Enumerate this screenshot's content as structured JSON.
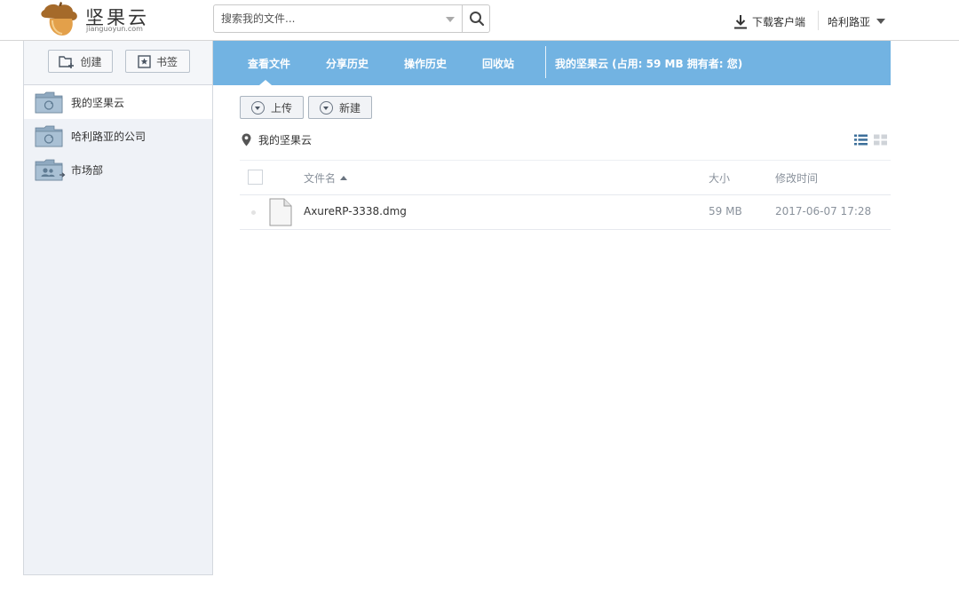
{
  "app": {
    "brand": "坚果云",
    "domain": "jianguoyun.com"
  },
  "search": {
    "placeholder": "搜索我的文件..."
  },
  "header": {
    "download_label": "下载客户端",
    "user_name": "哈利路亚"
  },
  "sidebar": {
    "create_label": "创建",
    "bookmark_label": "书签",
    "items": [
      {
        "label": "我的坚果云",
        "icon": "sync-folder-icon",
        "active": true
      },
      {
        "label": "哈利路亚的公司",
        "icon": "sync-folder-icon",
        "active": false
      },
      {
        "label": "市场部",
        "icon": "shared-folder-icon",
        "active": false
      }
    ]
  },
  "nav": {
    "tabs": [
      {
        "label": "查看文件",
        "active": true
      },
      {
        "label": "分享历史",
        "active": false
      },
      {
        "label": "操作历史",
        "active": false
      },
      {
        "label": "回收站",
        "active": false
      }
    ],
    "info": "我的坚果云  (占用:  59 MB    拥有者:  您)"
  },
  "actions": {
    "upload_label": "上传",
    "new_label": "新建"
  },
  "breadcrumb": {
    "current": "我的坚果云"
  },
  "table": {
    "columns": {
      "name": "文件名",
      "size": "大小",
      "modified": "修改时间"
    },
    "rows": [
      {
        "name": "AxureRP-3338.dmg",
        "size": "59 MB",
        "modified": "2017-06-07 17:28"
      }
    ]
  },
  "colors": {
    "accent": "#72b3e2",
    "sidebar_bg": "#eff2f7"
  }
}
